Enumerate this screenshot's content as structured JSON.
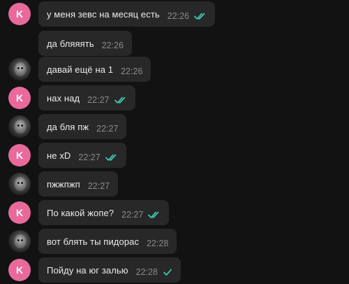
{
  "avatar_letter": "K",
  "accent_color": "#e96a9a",
  "read_check_color": "#3fd1b3",
  "messages": [
    {
      "text": "у меня зевс на месяц есть",
      "time": "22:26",
      "status": "read"
    },
    {
      "text": "да бляяять",
      "time": "22:26",
      "status": "none"
    },
    {
      "text": "давай ещё на 1",
      "time": "22:26",
      "status": "none"
    },
    {
      "text": "нах над",
      "time": "22:27",
      "status": "read"
    },
    {
      "text": "да бля пж",
      "time": "22:27",
      "status": "none"
    },
    {
      "text": "не xD",
      "time": "22:27",
      "status": "read"
    },
    {
      "text": "пжжпжп",
      "time": "22:27",
      "status": "none"
    },
    {
      "text": "По какой жопе?",
      "time": "22:27",
      "status": "read"
    },
    {
      "text": "вот блять ты пидорас",
      "time": "22:28",
      "status": "none"
    },
    {
      "text": "Пойду на юг залью",
      "time": "22:28",
      "status": "sent"
    }
  ]
}
